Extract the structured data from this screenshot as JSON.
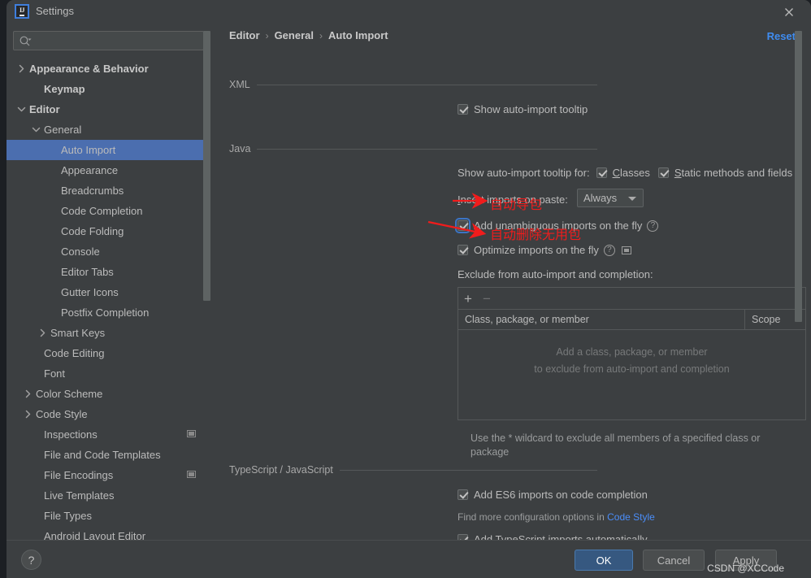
{
  "window": {
    "title": "Settings",
    "app_icon": "intellij-idea-icon",
    "close_icon": "close-icon"
  },
  "sidebar": {
    "search": {
      "placeholder": "",
      "value": "",
      "icon": "search-icon"
    },
    "items": [
      {
        "label": "Appearance & Behavior",
        "indent": 12,
        "arrow": "right",
        "bold": true,
        "selected": false,
        "badge": false
      },
      {
        "label": "Keymap",
        "indent": 30,
        "arrow": "none",
        "bold": true,
        "selected": false,
        "badge": false
      },
      {
        "label": "Editor",
        "indent": 12,
        "arrow": "down",
        "bold": true,
        "selected": false,
        "badge": false
      },
      {
        "label": "General",
        "indent": 30,
        "arrow": "down",
        "bold": false,
        "selected": false,
        "badge": false
      },
      {
        "label": "Auto Import",
        "indent": 51,
        "arrow": "none",
        "bold": false,
        "selected": true,
        "badge": false
      },
      {
        "label": "Appearance",
        "indent": 51,
        "arrow": "none",
        "bold": false,
        "selected": false,
        "badge": false
      },
      {
        "label": "Breadcrumbs",
        "indent": 51,
        "arrow": "none",
        "bold": false,
        "selected": false,
        "badge": false
      },
      {
        "label": "Code Completion",
        "indent": 51,
        "arrow": "none",
        "bold": false,
        "selected": false,
        "badge": false
      },
      {
        "label": "Code Folding",
        "indent": 51,
        "arrow": "none",
        "bold": false,
        "selected": false,
        "badge": false
      },
      {
        "label": "Console",
        "indent": 51,
        "arrow": "none",
        "bold": false,
        "selected": false,
        "badge": false
      },
      {
        "label": "Editor Tabs",
        "indent": 51,
        "arrow": "none",
        "bold": false,
        "selected": false,
        "badge": false
      },
      {
        "label": "Gutter Icons",
        "indent": 51,
        "arrow": "none",
        "bold": false,
        "selected": false,
        "badge": false
      },
      {
        "label": "Postfix Completion",
        "indent": 51,
        "arrow": "none",
        "bold": false,
        "selected": false,
        "badge": false
      },
      {
        "label": "Smart Keys",
        "indent": 38,
        "arrow": "right",
        "bold": false,
        "selected": false,
        "badge": false
      },
      {
        "label": "Code Editing",
        "indent": 30,
        "arrow": "none",
        "bold": false,
        "selected": false,
        "badge": false
      },
      {
        "label": "Font",
        "indent": 30,
        "arrow": "none",
        "bold": false,
        "selected": false,
        "badge": false
      },
      {
        "label": "Color Scheme",
        "indent": 20,
        "arrow": "right",
        "bold": false,
        "selected": false,
        "badge": false
      },
      {
        "label": "Code Style",
        "indent": 20,
        "arrow": "right",
        "bold": false,
        "selected": false,
        "badge": false
      },
      {
        "label": "Inspections",
        "indent": 30,
        "arrow": "none",
        "bold": false,
        "selected": false,
        "badge": true
      },
      {
        "label": "File and Code Templates",
        "indent": 30,
        "arrow": "none",
        "bold": false,
        "selected": false,
        "badge": false
      },
      {
        "label": "File Encodings",
        "indent": 30,
        "arrow": "none",
        "bold": false,
        "selected": false,
        "badge": true
      },
      {
        "label": "Live Templates",
        "indent": 30,
        "arrow": "none",
        "bold": false,
        "selected": false,
        "badge": false
      },
      {
        "label": "File Types",
        "indent": 30,
        "arrow": "none",
        "bold": false,
        "selected": false,
        "badge": false
      },
      {
        "label": "Android Layout Editor",
        "indent": 30,
        "arrow": "none",
        "bold": false,
        "selected": false,
        "badge": false
      }
    ]
  },
  "main": {
    "breadcrumb": {
      "crumb1": "Editor",
      "crumb2": "General",
      "crumb3": "Auto Import",
      "separator": "›"
    },
    "reset_label": "Reset",
    "xml": {
      "group_title": "XML",
      "show_tooltip": {
        "label": "Show auto-import tooltip",
        "checked": true
      }
    },
    "java": {
      "group_title": "Java",
      "tooltip_for_label": "Show auto-import tooltip for:",
      "classes": {
        "label": "Classes",
        "mnemonic": "C",
        "rest": "lasses",
        "checked": true
      },
      "static_methods": {
        "label": "Static methods and fields",
        "mnemonic": "S",
        "rest": "tatic methods and fields",
        "checked": true
      },
      "insert_imports_label": "Insert imports on paste:",
      "insert_imports_mnemonic": "I",
      "insert_imports_rest": "nsert imports on paste:",
      "insert_imports_value": "Always",
      "add_unambiguous": {
        "label": "Add unambiguous imports on the fly",
        "checked": true,
        "focused": true,
        "help_icon": "help-icon"
      },
      "optimize_imports": {
        "label": "Optimize imports on the fly",
        "checked": true,
        "help_icon": "help-icon",
        "project_icon": "project-settings-icon"
      },
      "exclude_label": "Exclude from auto-import and completion:",
      "table": {
        "add_button": "+",
        "remove_button": "−",
        "columns": [
          "Class, package, or member",
          "Scope"
        ],
        "empty_line1": "Add a class, package, or member",
        "empty_line2": "to exclude from auto-import and completion"
      },
      "wildcard_hint": "Use the * wildcard to exclude all members of a specified class or package"
    },
    "typescript": {
      "group_title": "TypeScript / JavaScript",
      "es6": {
        "label": "Add ES6 imports on code completion",
        "checked": true
      },
      "config_hint_prefix": "Find more configuration options in ",
      "config_hint_link": "Code Style",
      "typescript_auto": {
        "label": "Add TypeScript imports automatically",
        "checked": true
      }
    }
  },
  "annotations": [
    {
      "text": "自动导包",
      "color": "#f01c1c"
    },
    {
      "text": "自动删除无用包",
      "color": "#f01c1c"
    }
  ],
  "footer": {
    "help_label": "?",
    "ok_label": "OK",
    "cancel_label": "Cancel",
    "apply_label": "Apply",
    "apply_mnemonic": "A",
    "apply_rest": "pply",
    "watermark": "CSDN @XCCode"
  },
  "colors": {
    "accent_blue": "#4b6eaf",
    "link_blue": "#3f8cf0",
    "annotation_red": "#f01c1c",
    "panel_bg": "#3c3f41",
    "ok_button": "#365880"
  }
}
